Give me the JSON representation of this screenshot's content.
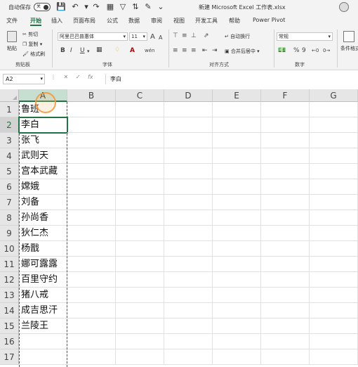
{
  "titlebar": {
    "autosave_label": "自动保存",
    "autosave_state": "关",
    "title": "新建 Microsoft Excel 工作表.xlsx",
    "icons": [
      "save-icon",
      "undo-icon",
      "redo-icon",
      "customize-icon",
      "filter-icon",
      "sort-icon",
      "pen-icon"
    ]
  },
  "tabs": [
    "文件",
    "开始",
    "插入",
    "页面布局",
    "公式",
    "数据",
    "审阅",
    "视图",
    "开发工具",
    "帮助",
    "Power Pivot"
  ],
  "active_tab": "开始",
  "ribbon": {
    "clipboard": {
      "paste": "粘贴",
      "cut": "剪切",
      "copy": "复制",
      "format_painter": "格式刷",
      "label": "剪贴板"
    },
    "font": {
      "name": "阿里巴巴普惠体",
      "size": "11",
      "label": "字体",
      "bold": "B",
      "italic": "I",
      "underline": "U",
      "grow": "A",
      "shrink": "A",
      "font_color": "A",
      "phonetic": "wén"
    },
    "alignment": {
      "wrap": "自动换行",
      "merge": "合并后居中",
      "label": "对齐方式"
    },
    "number": {
      "format": "常规",
      "percent": "%",
      "comma": "9",
      "label": "数字"
    },
    "styles": {
      "conditional": "条件格式"
    }
  },
  "formula_bar": {
    "name_box": "A2",
    "fx": "fx",
    "content": "李白"
  },
  "columns": [
    "A",
    "B",
    "C",
    "D",
    "E",
    "F",
    "G"
  ],
  "selected_column": "A",
  "rows": [
    {
      "num": "1",
      "a": "鲁班"
    },
    {
      "num": "2",
      "a": "李白"
    },
    {
      "num": "3",
      "a": "张飞"
    },
    {
      "num": "4",
      "a": "武则天"
    },
    {
      "num": "5",
      "a": "宫本武藏"
    },
    {
      "num": "6",
      "a": "嫦娥"
    },
    {
      "num": "7",
      "a": "刘备"
    },
    {
      "num": "8",
      "a": "孙尚香"
    },
    {
      "num": "9",
      "a": "狄仁杰"
    },
    {
      "num": "10",
      "a": "杨戬"
    },
    {
      "num": "11",
      "a": "娜可露露"
    },
    {
      "num": "12",
      "a": "百里守约"
    },
    {
      "num": "13",
      "a": "猪八戒"
    },
    {
      "num": "14",
      "a": "成吉思汗"
    },
    {
      "num": "15",
      "a": "兰陵王"
    },
    {
      "num": "16",
      "a": ""
    },
    {
      "num": "17",
      "a": ""
    }
  ],
  "active_row": "2",
  "colors": {
    "accent": "#217346"
  }
}
